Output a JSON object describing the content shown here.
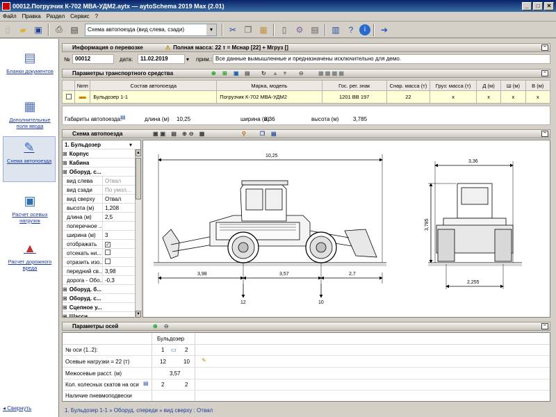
{
  "window": {
    "title": "00012.Погрузчик К-702 МВА-УДМ2.aytx — aytoSchema 2019 Max (2.01)"
  },
  "menu": [
    "Файл",
    "Правка",
    "Раздел",
    "Сервис",
    "?"
  ],
  "toolbar": {
    "view_select": "Схема автопоезда (вид слева, сзади)"
  },
  "sidebar": {
    "items": [
      {
        "label": "Бланки документов",
        "icon": "documents-icon"
      },
      {
        "label": "Дополнительные поля ввода",
        "icon": "table-icon"
      },
      {
        "label": "Схема автопоезда",
        "icon": "scheme-icon"
      },
      {
        "label": "Расчет осевых нагрузок",
        "icon": "axle-load-icon"
      },
      {
        "label": "Расчет дорожного вреда",
        "icon": "road-damage-icon"
      }
    ],
    "collapse": "Свернуть"
  },
  "transport_info": {
    "header": "Информация о перевозке",
    "warning": "Полная масса: 22 т = Мснар [22] + Мгруз []",
    "number_label": "№",
    "number": "00012",
    "date_label": "дата:",
    "date": "11.02.2019",
    "note_label": "прим.:",
    "note": "Все данные вымышленные и предназначены исключительно для демо."
  },
  "vehicle_params": {
    "header": "Параметры транспортного средства",
    "columns": [
      "№пп",
      "Состав автопоезда",
      "Марка, модель",
      "Гос. рег. знак",
      "Снар. масса (т)",
      "Груз: масса (т)",
      "Д (м)",
      "Ш (м)",
      "В (м)"
    ],
    "rows": [
      {
        "name": "Бульдозер 1-1",
        "model": "Погрузчик К-702 МВА-УДМ2",
        "reg": "1201 ВВ 197",
        "mass": "22",
        "cargo": "x",
        "d": "x",
        "w": "x",
        "h": "x"
      }
    ],
    "dims_label": "Габариты автопоезда:",
    "length_label": "длина (м)",
    "length": "10,25",
    "width_label": "ширина (м)",
    "width": "3,36",
    "height_label": "высота (м)",
    "height": "3,785"
  },
  "scheme": {
    "header": "Схема автопоезда",
    "tree_title": "1. Бульдозер",
    "tree": [
      {
        "group": true,
        "label": "Корпус"
      },
      {
        "group": true,
        "label": "Кабина"
      },
      {
        "group": true,
        "label": "Оборуд. с..."
      },
      {
        "key": "вид слева",
        "value": "Отвал",
        "gray": true
      },
      {
        "key": "вид сзади",
        "value": "По умол...",
        "gray": true
      },
      {
        "key": "вид сверху",
        "value": "Отвал"
      },
      {
        "key": "высота (м)",
        "value": "1,208"
      },
      {
        "key": "длина (м)",
        "value": "2,5"
      },
      {
        "key": "поперечное ...",
        "value": ""
      },
      {
        "key": "ширина (м)",
        "value": "3"
      },
      {
        "key": "отображать",
        "value": "",
        "check": true
      },
      {
        "key": "отсекать ни...",
        "value": "",
        "check": false
      },
      {
        "key": "отразить изо...",
        "value": "",
        "check": false
      },
      {
        "key": "передний св...",
        "value": "3,98"
      },
      {
        "key": "дорога - Обо...",
        "value": "-0,3"
      },
      {
        "group": true,
        "label": "Оборуд. б..."
      },
      {
        "group": true,
        "label": "Оборуд. с..."
      },
      {
        "group": true,
        "label": "Сцепное у..."
      },
      {
        "group": true,
        "label": "Шасси"
      }
    ],
    "dims": {
      "total_length": "10,25",
      "front": "3,98",
      "wheelbase": "3,57",
      "rear": "2,7",
      "axle1_load": "12",
      "axle2_load": "10",
      "width": "3,36",
      "height": "3,785",
      "track": "2,255"
    }
  },
  "axle_params": {
    "header": "Параметры осей",
    "vehicle": "Бульдозер",
    "rows": [
      {
        "label": "№ оси (1..2):",
        "v1": "1",
        "v2": "2"
      },
      {
        "label": "Осевые нагрузки = 22 (т)",
        "v1": "12",
        "v2": "10"
      },
      {
        "label": "Межосевые расст. (м)",
        "v1": "3,57",
        "v2": ""
      },
      {
        "label": "Кол. колесных скатов на оси",
        "v1": "2",
        "v2": "2"
      },
      {
        "label": "Наличие пневмоподвески",
        "v1": "",
        "v2": ""
      }
    ]
  },
  "statusbar": {
    "breadcrumb": "1. Бульдозер 1-1  »  Оборуд. спереди  »  вид сверху :  Отвал"
  }
}
